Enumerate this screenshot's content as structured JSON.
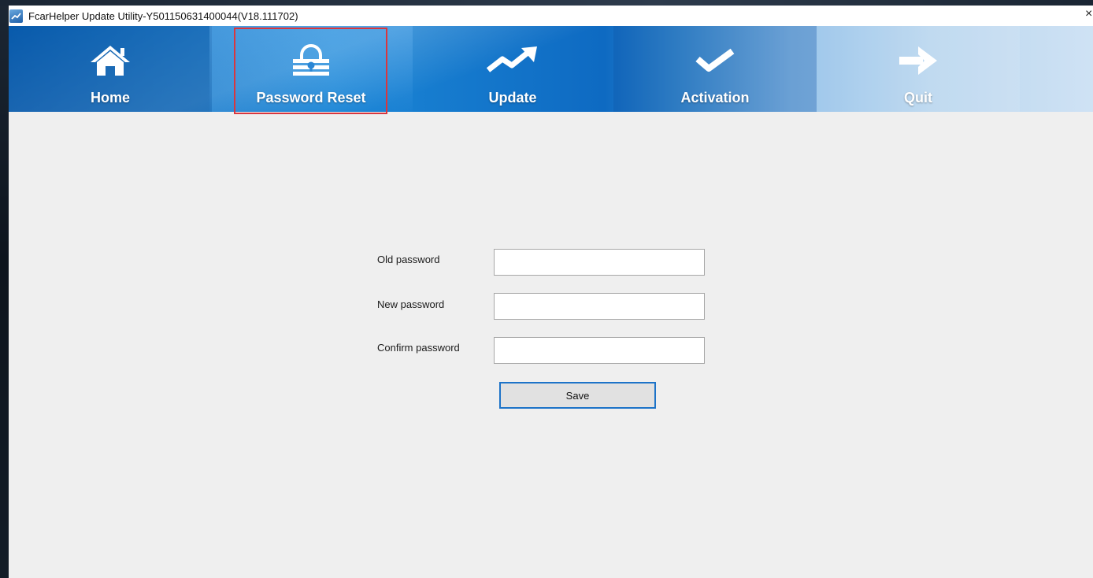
{
  "window": {
    "title": "FcarHelper Update Utility-Y501150631400044(V18.111702)",
    "close_glyph": "×"
  },
  "toolbar": {
    "items": [
      {
        "label": "Home",
        "icon": "home-icon"
      },
      {
        "label": "Password Reset",
        "icon": "lock-icon"
      },
      {
        "label": "Update",
        "icon": "trend-up-icon"
      },
      {
        "label": "Activation",
        "icon": "checkmark-icon"
      },
      {
        "label": "Quit",
        "icon": "arrow-right-icon"
      }
    ],
    "selected": "Password Reset"
  },
  "form": {
    "old_password_label": "Old password",
    "new_password_label": "New password",
    "confirm_password_label": "Confirm password",
    "old_password_value": "",
    "new_password_value": "",
    "confirm_password_value": "",
    "save_label": "Save"
  },
  "colors": {
    "toolbar_blue": "#0a63b8",
    "highlight_red": "#d9363e",
    "button_border": "#1d73c8",
    "content_bg": "#efefef"
  }
}
